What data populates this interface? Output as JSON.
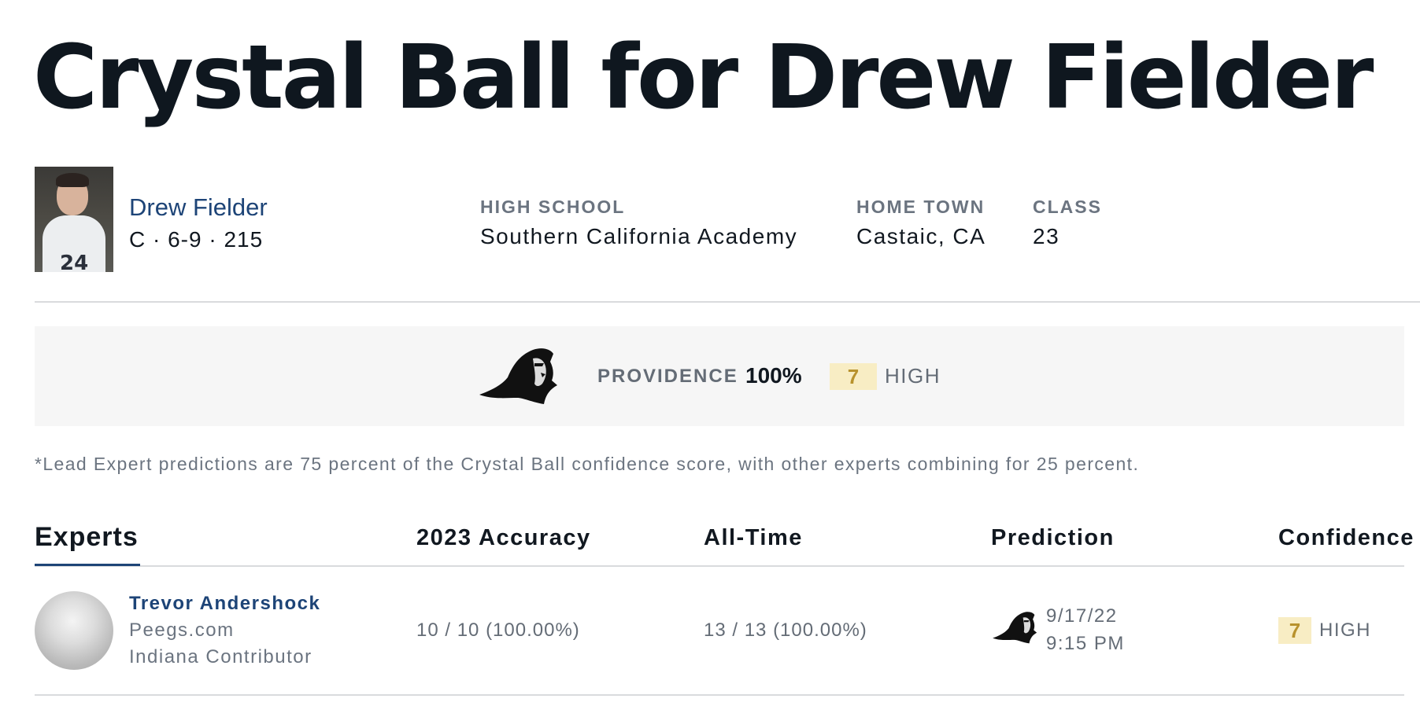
{
  "page": {
    "title": "Crystal Ball for Drew Fielder"
  },
  "player": {
    "name": "Drew Fielder",
    "meta": "C · 6-9 · 215",
    "photo_number": "24",
    "high_school_label": "HIGH SCHOOL",
    "high_school": "Southern California Academy",
    "hometown_label": "HOME TOWN",
    "hometown": "Castaic, CA",
    "class_label": "CLASS",
    "class": "23"
  },
  "prediction_summary": {
    "logo_icon": "providence-friar-logo-icon",
    "school": "PROVIDENCE",
    "percent": "100%",
    "confidence": "7",
    "confidence_level": "HIGH"
  },
  "footnote": "*Lead Expert predictions are 75 percent of the Crystal Ball confidence score, with other experts combining for 25 percent.",
  "experts_table": {
    "headers": {
      "experts": "Experts",
      "accuracy": "2023 Accuracy",
      "all_time": "All-Time",
      "prediction": "Prediction",
      "confidence": "Confidence"
    },
    "rows": [
      {
        "name": "Trevor Andershock",
        "site": "Peegs.com",
        "role": "Indiana Contributor",
        "accuracy": "10 / 10 (100.00%)",
        "all_time": "13 / 13 (100.00%)",
        "prediction_logo": "providence-friar-logo-icon",
        "date": "9/17/22",
        "time": "9:15 PM",
        "confidence": "7",
        "confidence_level": "HIGH"
      }
    ]
  },
  "colors": {
    "accent_blue": "#1d4477",
    "badge_bg": "#f8edc4",
    "badge_text": "#b8922d",
    "banner_bg": "#f6f6f6"
  }
}
